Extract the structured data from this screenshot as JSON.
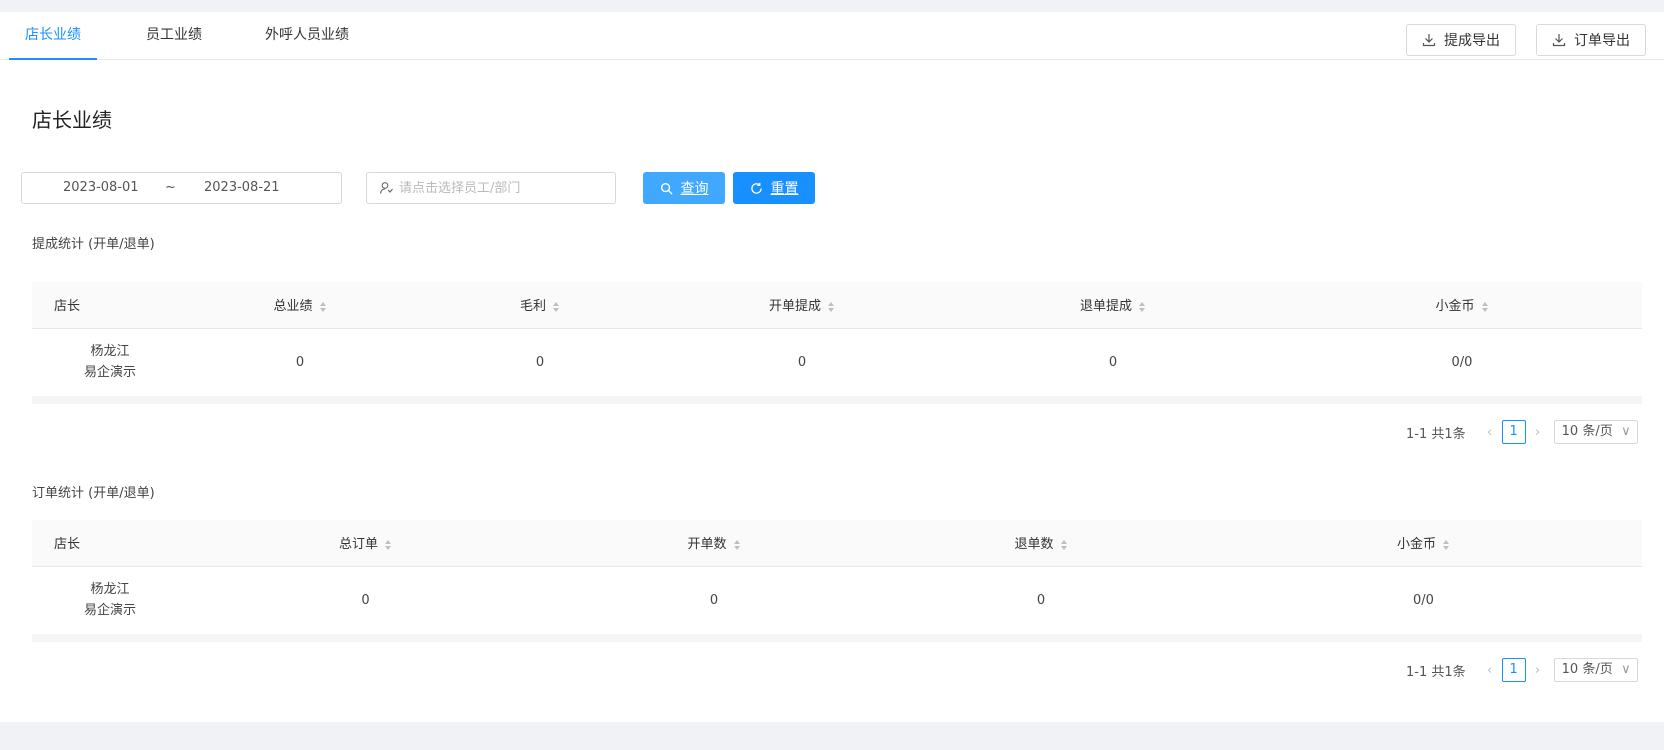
{
  "tabs": [
    {
      "label": "店长业绩",
      "active": true
    },
    {
      "label": "员工业绩",
      "active": false
    },
    {
      "label": "外呼人员业绩",
      "active": false
    }
  ],
  "header_buttons": {
    "commission_export": "提成导出",
    "order_export": "订单导出"
  },
  "page_title": "店长业绩",
  "filters": {
    "date_start": "2023-08-01",
    "date_separator": "~",
    "date_end": "2023-08-21",
    "employee_placeholder": "请点击选择员工/部门",
    "query_label": "查询",
    "reset_label": "重置"
  },
  "commission_section": {
    "title": "提成统计 (开单/退单)",
    "columns": [
      "店长",
      "总业绩",
      "毛利",
      "开单提成",
      "退单提成",
      "小金币"
    ],
    "rows": [
      {
        "manager_line1": "杨龙江",
        "manager_line2": "易企演示",
        "cells": [
          "0",
          "0",
          "0",
          "0",
          "0/0"
        ]
      }
    ],
    "pagination": {
      "total_text": "1-1 共1条",
      "current_page": "1",
      "page_size": "10 条/页"
    }
  },
  "order_section": {
    "title": "订单统计 (开单/退单)",
    "columns": [
      "店长",
      "总订单",
      "开单数",
      "退单数",
      "小金币"
    ],
    "rows": [
      {
        "manager_line1": "杨龙江",
        "manager_line2": "易企演示",
        "cells": [
          "0",
          "0",
          "0",
          "0/0"
        ]
      }
    ],
    "pagination": {
      "total_text": "1-1 共1条",
      "current_page": "1",
      "page_size": "10 条/页"
    }
  },
  "colors": {
    "accent": "#1890ff",
    "query_button": "#40a9ff",
    "page_background": "#f0f2f5"
  }
}
